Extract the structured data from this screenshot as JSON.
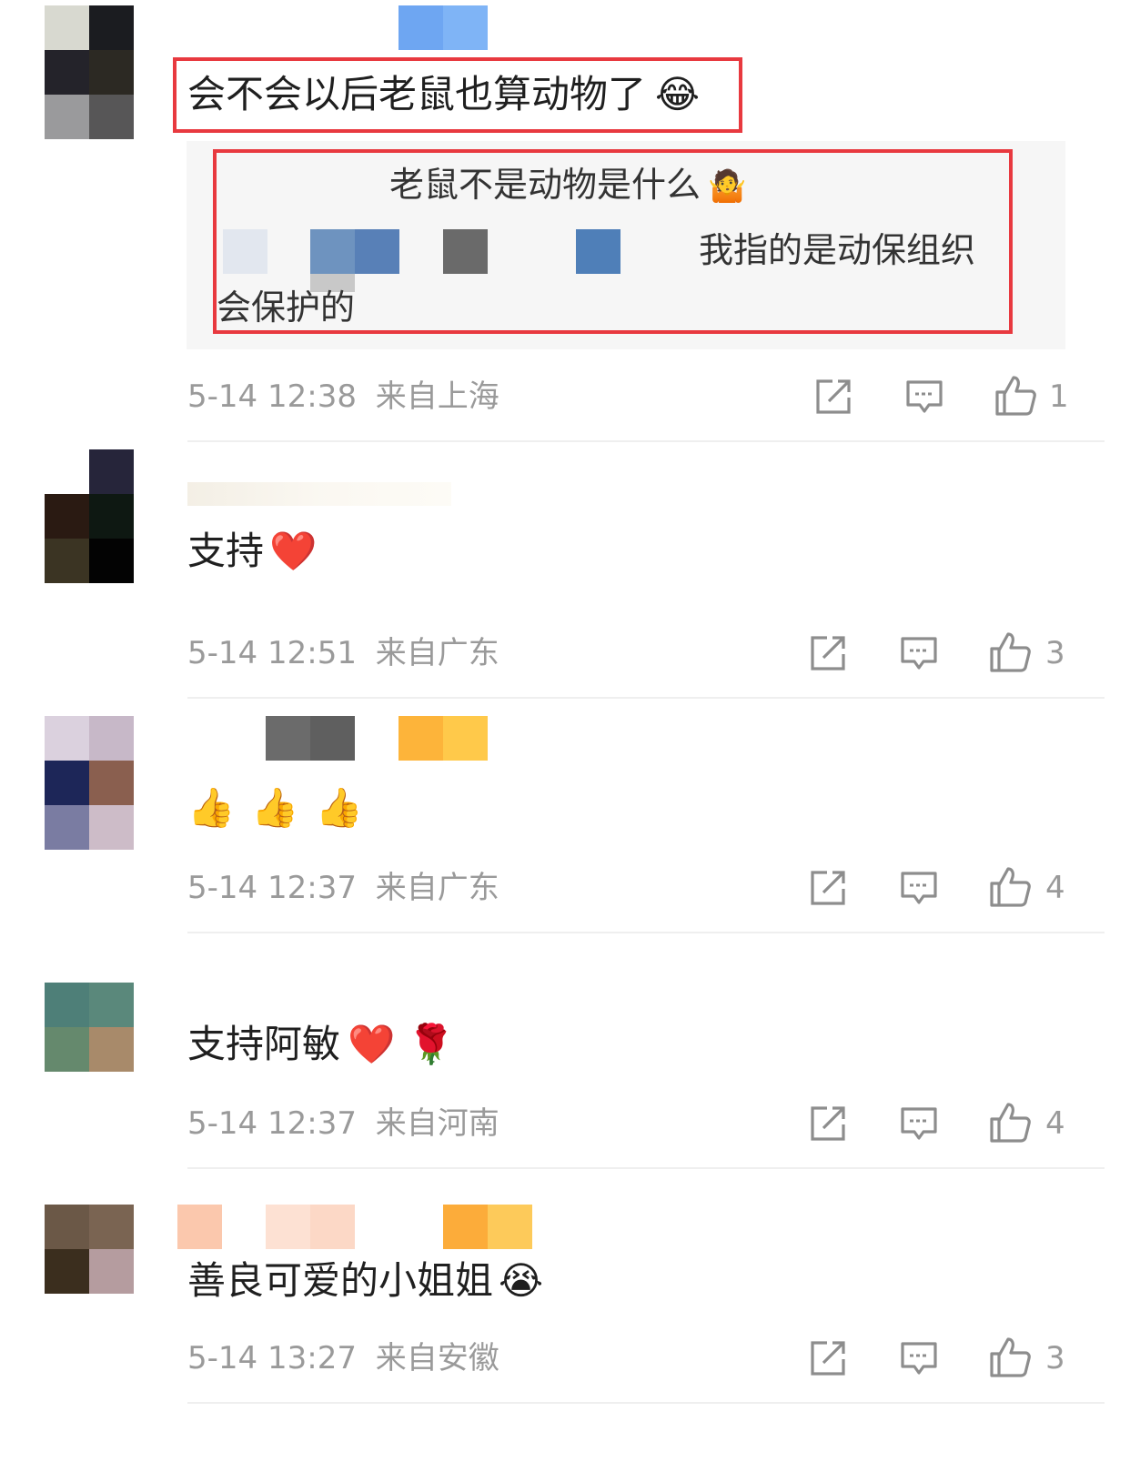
{
  "comments": [
    {
      "text": "会不会以后老鼠也算动物了",
      "emoji": "😂",
      "replies": {
        "line1": "老鼠不是动物是什么",
        "line1_emoji": "🤷",
        "line2": "我指的是动保组织",
        "line3": "会保护的"
      },
      "time": "5-14 12:38",
      "location": "来自上海",
      "likes": "1"
    },
    {
      "text": "支持",
      "emoji": "❤️",
      "time": "5-14 12:51",
      "location": "来自广东",
      "likes": "3"
    },
    {
      "text": "",
      "emoji": "👍👍👍",
      "time": "5-14 12:37",
      "location": "来自广东",
      "likes": "4"
    },
    {
      "text": "支持阿敏",
      "emoji": "❤️ 🌹",
      "time": "5-14 12:37",
      "location": "来自河南",
      "likes": "4"
    },
    {
      "text": "善良可爱的小姐姐",
      "emoji": "😭",
      "time": "5-14 13:27",
      "location": "来自安徽",
      "likes": "3"
    }
  ],
  "icons": {
    "share": "share-icon",
    "reply": "comment-icon",
    "like": "thumbs-up-icon"
  },
  "colors": {
    "highlight": "#e8393f",
    "meta": "#9a9a9a",
    "reply_bg": "#f6f6f6"
  }
}
